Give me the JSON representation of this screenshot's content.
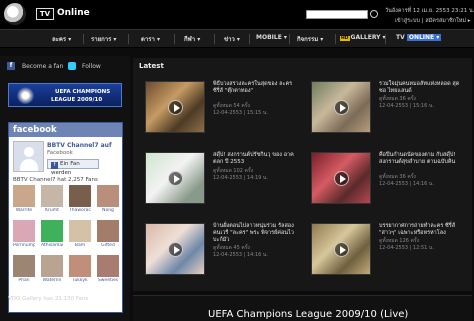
{
  "header": {
    "tv_label": "TV",
    "online_label": "Online",
    "date_text": "วันอังคารที่ 12 เม.ย. 2553 23:21 น.",
    "auth_text": "เข้าสู่ระบบ | สมัครสมาชิกใหม่ ▸"
  },
  "nav": {
    "items": [
      "ละคร ▾",
      "รายการ ▾",
      "ดารา ▾",
      "กีฬา ▾",
      "ข่าว ▾",
      "MOBILE ▾",
      "กิจกรรม ▾",
      "GALLERY ▾",
      "TV",
      "ONLINE ▾"
    ],
    "hd_badge": "HD"
  },
  "sidebar": {
    "fan_label": "Become a fan",
    "follow_label": "Follow",
    "uefa_line1": "UEFA CHAMPIONS",
    "uefa_line2": "LEAGUE 2009/10",
    "fb_header": "facebook",
    "fb_channel": "BBTV Channel7 auf",
    "fb_channel_sub": "Facebook",
    "fb_button": "Ein Fan werden",
    "fb_count": "BBTV Channel7 hat 2,257 Fans",
    "fans": [
      {
        "name": "Warrite",
        "color": "#caa68a"
      },
      {
        "name": "Krumt",
        "color": "#c6b6a8"
      },
      {
        "name": "Thaworachai",
        "color": "#7a5e4d"
      },
      {
        "name": "Nong",
        "color": "#b98e7b"
      },
      {
        "name": "Pornnumpai",
        "color": "#d9a7b6"
      },
      {
        "name": "Athisaman",
        "color": "#3fb05c"
      },
      {
        "name": "Bam",
        "color": "#d3c2a8"
      },
      {
        "name": "Gifted",
        "color": "#a47c6a"
      },
      {
        "name": "Phan",
        "color": "#9d8573"
      },
      {
        "name": "Waterlin",
        "color": "#b9a391"
      },
      {
        "name": "Tukkyk",
        "color": "#c18e7a"
      },
      {
        "name": "Sweeties",
        "color": "#a97c72"
      }
    ],
    "vdo_gallery_count": "VDO Gallery has 21,130 Fans"
  },
  "latest": {
    "title": "Latest",
    "videos": [
      {
        "title": "พิธีบวงสรวงละครในสุดของ ละครซีรี่ส์ \"ตุ๊กตาทอง\"",
        "meta": "ดูทั้งหมด 54 ครั้ง\n12-04-2553 | 15:15 น.",
        "thumb": "linear-gradient(135deg,#6d4b2f,#c59b64 40%,#4d3a24 70%,#8d6f4a)"
      },
      {
        "title": "รวมใจมุ่นคนหมอลัทแห่งหลอด สุดซอ ไทยแลนด์",
        "meta": "ดูทั้งหมด 36 ครั้ง\n12-04-2553 | 15:16 น.",
        "thumb": "linear-gradient(135deg,#6f7c5e,#c8b89b 40%,#7c6b57 70%,#b59d7f)"
      },
      {
        "title": "สดุ๊ป! สงกรานต์ปรัชกินวุ ของ อาคตลก ปี 2553",
        "meta": "ดูทั้งหมด 102 ครั้ง\n12-04-2553 | 14:19 น.",
        "thumb": "linear-gradient(135deg,#cfe6cf,#f2f2f2 45%,#8a9a8a 80%)"
      },
      {
        "title": "คือปีนกำนดนัดของตาม กับสดุ๊ป! สงกรานต์สุขสำบาย ตามฉบับคิน",
        "meta": "ดูทั้งหมด 36 ครั้ง\n12-04-2553 | 14:16 น.",
        "thumb": "linear-gradient(135deg,#7a1f2a,#d45b62 40%,#5b2a2a 70%,#b24852)"
      },
      {
        "title": "บ้านฝั่งตอนไปลาวหนุ่มร่วม รัลสองคนเวรี \"ละคร\" พระ พิจารย์ค่อนไวบะก์มัว",
        "meta": "ดูทั้งหมด 45 ครั้ง\n12-04-2553 | 14:16 น.",
        "thumb": "linear-gradient(135deg,#d8b8a8,#f0dfd6 40%,#6e88a8 70%,#e7d0c3)"
      },
      {
        "title": "บรรยากาศการถ่ายทำละคร ซีรี่ส์ \"สาวๆ\" เฉพาะหรือหรหาโลง",
        "meta": "ดูทั้งหมด 126 ครั้ง\n12-04-2553 | 12:51 น.",
        "thumb": "linear-gradient(135deg,#8f7a4e,#d7c79b 40%,#6f5f3e 70%,#c2ab7a)"
      }
    ]
  },
  "bottom": {
    "title": "UEFA Champions League 2009/10 (Live)"
  }
}
